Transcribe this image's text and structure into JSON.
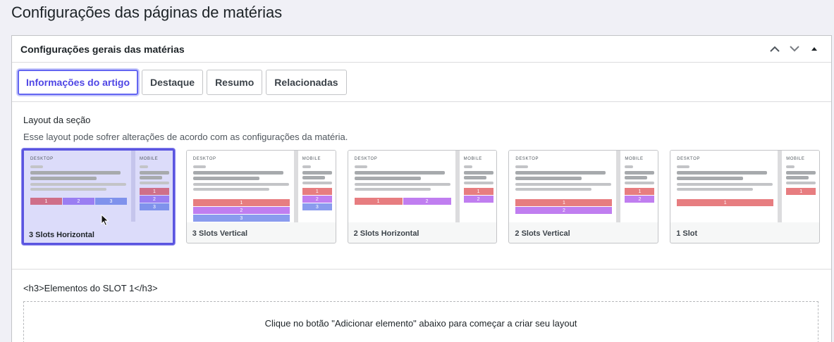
{
  "page": {
    "title": "Configurações das páginas de matérias"
  },
  "postbox": {
    "title": "Configurações gerais das matérias",
    "icons": [
      "chevron-up-icon",
      "chevron-down-icon",
      "triangle-up-icon"
    ]
  },
  "tabs": [
    {
      "label": "Informações do artigo",
      "active": true
    },
    {
      "label": "Destaque",
      "active": false
    },
    {
      "label": "Resumo",
      "active": false
    },
    {
      "label": "Relacionadas",
      "active": false
    }
  ],
  "section": {
    "label": "Layout da seção",
    "description": "Esse layout pode sofrer alterações de acordo com as configurações da matéria."
  },
  "preview_labels": {
    "desktop": "DESKTOP",
    "mobile": "MOBILE"
  },
  "layouts": [
    {
      "name": "3 Slots Horizontal",
      "selected": true,
      "desktop_slots": [
        "1",
        "2",
        "3"
      ],
      "mobile_slots": [
        "1",
        "2",
        "3"
      ]
    },
    {
      "name": "3 Slots Vertical",
      "selected": false,
      "desktop_slots": [
        "1",
        "2",
        "3"
      ],
      "mobile_slots": [
        "1",
        "2",
        "3"
      ]
    },
    {
      "name": "2 Slots Horizontal",
      "selected": false,
      "desktop_slots": [
        "1",
        "2"
      ],
      "mobile_slots": [
        "1",
        "2"
      ]
    },
    {
      "name": "2 Slots Vertical",
      "selected": false,
      "desktop_slots": [
        "1",
        "2"
      ],
      "mobile_slots": [
        "1",
        "2"
      ]
    },
    {
      "name": "1 Slot",
      "selected": false,
      "desktop_slots": [
        "1"
      ],
      "mobile_slots": [
        "1"
      ]
    }
  ],
  "slot_section": {
    "heading": "<h3>Elementos do SLOT 1</h3>",
    "empty_message": "Clique no botão \"Adicionar elemento\" abaixo para começar a criar seu layout"
  },
  "colors": {
    "accent": "#5b55e0",
    "slot1": "#e77d80",
    "slot2": "#c07ef0",
    "slot3": "#8a9bee"
  }
}
